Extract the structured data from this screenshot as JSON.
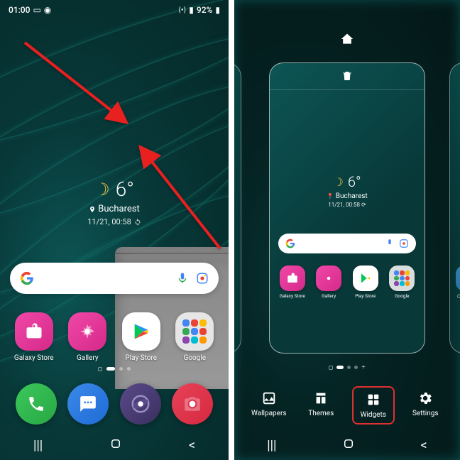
{
  "status": {
    "time": "01:00",
    "battery": "92%"
  },
  "weather": {
    "temp": "6°",
    "location": "Bucharest",
    "datetime": "11/21, 00:58"
  },
  "apps": {
    "galaxy_store": "Galaxy Store",
    "gallery": "Gallery",
    "play_store": "Play Store",
    "google": "Google",
    "clock_partial": "Clo"
  },
  "edit_tools": {
    "wallpapers": "Wallpapers",
    "themes": "Themes",
    "widgets": "Widgets",
    "settings": "Settings"
  },
  "colors": {
    "accent_red": "#e03030",
    "arrow": "#e82020"
  }
}
